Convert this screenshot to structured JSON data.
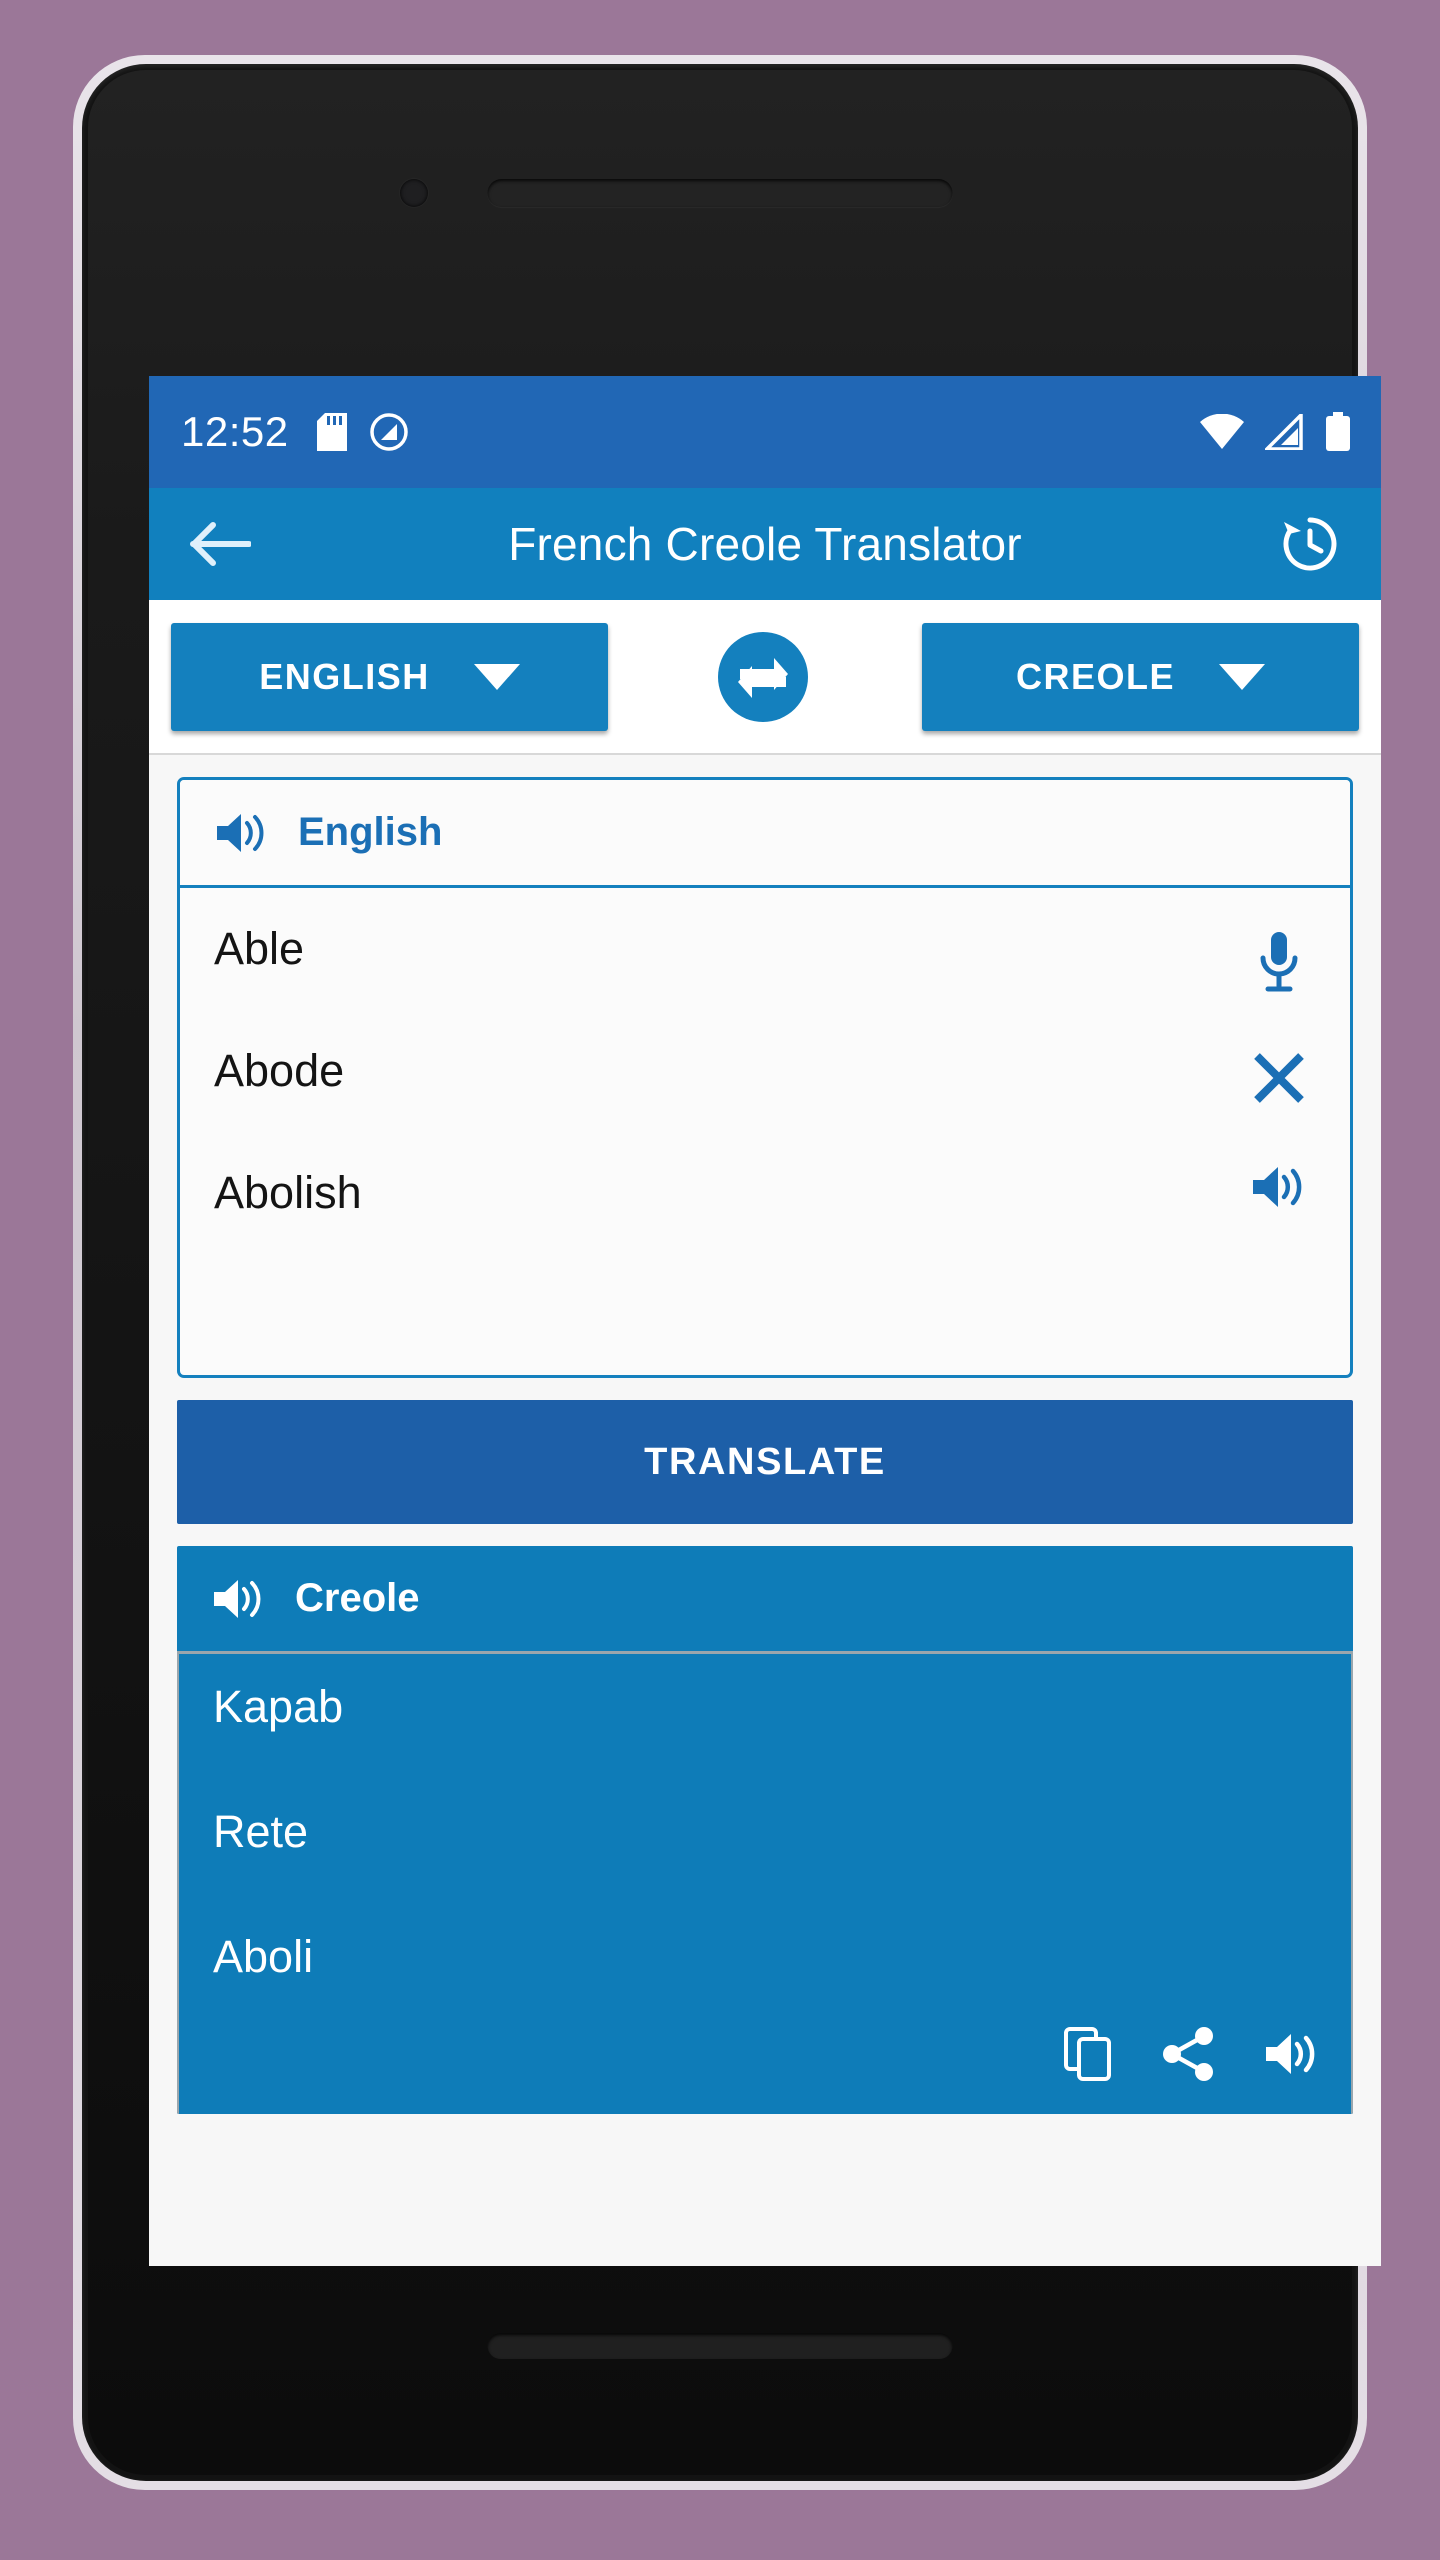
{
  "status_bar": {
    "time": "12:52",
    "left_icons": [
      "sd-card-icon",
      "do-not-disturb-icon"
    ],
    "right_icons": [
      "wifi-icon",
      "signal-icon",
      "battery-icon"
    ],
    "background_color": "#2167B5"
  },
  "app_bar": {
    "title": "French Creole Translator",
    "back_icon": "back-arrow-icon",
    "history_icon": "history-icon",
    "background_color": "#1180BE"
  },
  "language_selector": {
    "source_language": "ENGLISH",
    "target_language": "CREOLE",
    "swap_icon": "swap-horizontal-icon",
    "button_color": "#1480BE"
  },
  "source_panel": {
    "speaker_icon": "speaker-icon",
    "label": "English",
    "lines": [
      "Able",
      "Abode",
      "Abolish"
    ],
    "actions": [
      {
        "name": "mic-icon",
        "label": "Voice input"
      },
      {
        "name": "close-icon",
        "label": "Clear"
      },
      {
        "name": "speaker-icon",
        "label": "Speak"
      }
    ],
    "accent_color": "#1480BE"
  },
  "translate_button": {
    "label": "TRANSLATE",
    "color": "#1D5FA8"
  },
  "target_panel": {
    "speaker_icon": "speaker-icon",
    "label": "Creole",
    "lines": [
      "Kapab",
      "Rete",
      "Aboli"
    ],
    "actions": [
      {
        "name": "copy-icon",
        "label": "Copy"
      },
      {
        "name": "share-icon",
        "label": "Share"
      },
      {
        "name": "speaker-icon",
        "label": "Speak"
      }
    ],
    "background_color": "#0E7CB8"
  },
  "page": {
    "background_color": "#9B7798"
  }
}
